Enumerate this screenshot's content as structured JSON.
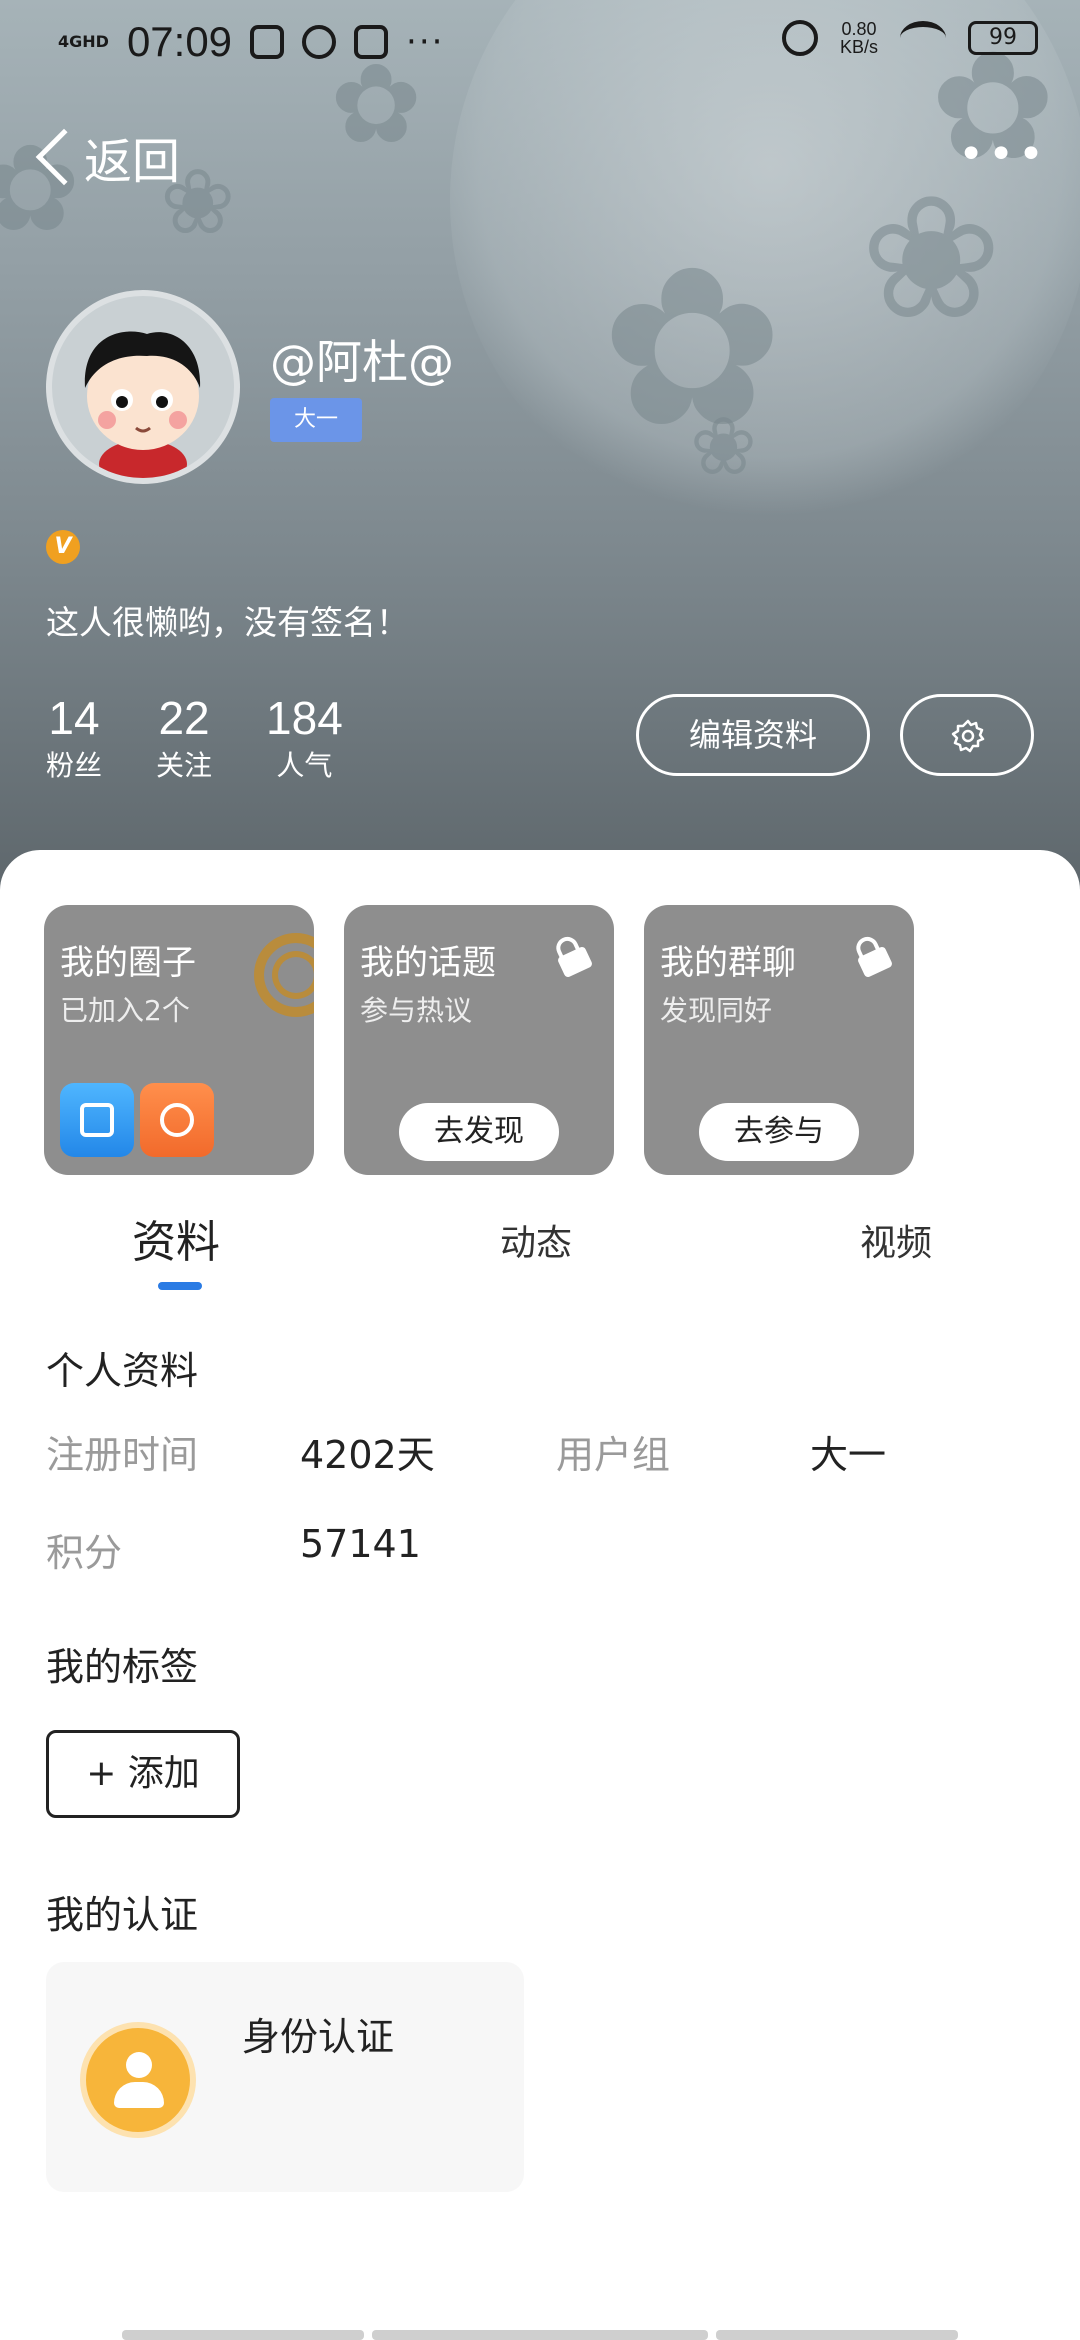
{
  "status_bar": {
    "network": "4GHD",
    "time": "07:09",
    "speed_value": "0.80",
    "speed_unit": "KB/s",
    "battery": "99",
    "more": "···"
  },
  "nav": {
    "back_label": "返回",
    "more": "•••"
  },
  "profile": {
    "nickname": "@阿杜@",
    "grade_badge": "大一",
    "verified_badge": "V",
    "signature": "这人很懒哟，没有签名！",
    "stats": [
      {
        "value": "14",
        "label": "粉丝"
      },
      {
        "value": "22",
        "label": "关注"
      },
      {
        "value": "184",
        "label": "人气"
      }
    ],
    "edit_button": "编辑资料"
  },
  "cards": [
    {
      "title": "我的圈子",
      "subtitle": "已加入2个"
    },
    {
      "title": "我的话题",
      "subtitle": "参与热议",
      "button": "去发现"
    },
    {
      "title": "我的群聊",
      "subtitle": "发现同好",
      "button": "去参与"
    }
  ],
  "tabs": [
    "资料",
    "动态",
    "视频"
  ],
  "profile_info": {
    "title": "个人资料",
    "fields": [
      {
        "label": "注册时间",
        "value": "4202天"
      },
      {
        "label": "用户组",
        "value": "大一"
      },
      {
        "label": "积分",
        "value": "57141"
      }
    ]
  },
  "tags": {
    "title": "我的标签",
    "add_button": "+ 添加"
  },
  "certification": {
    "title": "我的认证",
    "card_title": "身份认证"
  },
  "colors": {
    "accent": "#2a7be4",
    "grade_badge": "#6b95e8",
    "verified": "#f0a020",
    "card_bg": "#8e8e8e"
  }
}
